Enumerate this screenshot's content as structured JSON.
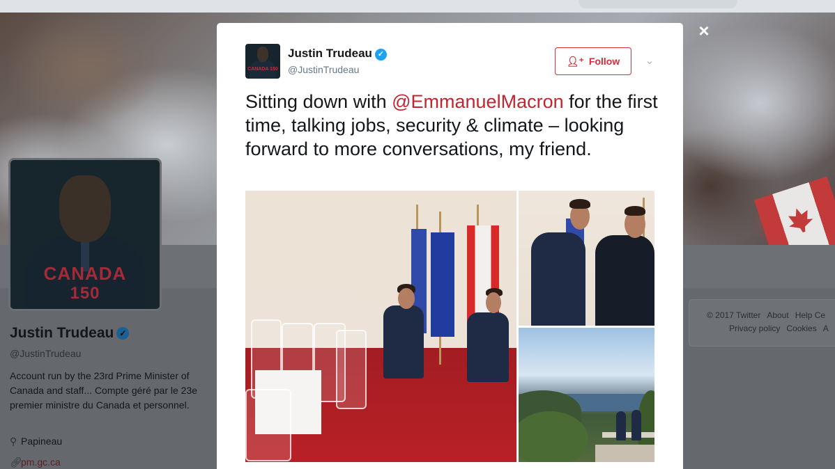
{
  "background": {
    "profile_name": "Justin Trudeau",
    "profile_handle": "@JustinTrudeau",
    "bio": "Account run by the 23rd Prime Minister of Canada and staff... Compte géré par le 23e premier ministre du Canada et personnel.",
    "location": "Papineau",
    "website": "pm.gc.ca",
    "avatar_text_1": "CANADA",
    "avatar_text_2": "150",
    "footer_links": [
      "© 2017 Twitter",
      "About",
      "Help Ce",
      "Privacy policy",
      "Cookies",
      "A"
    ]
  },
  "modal": {
    "close_label": "×",
    "author_name": "Justin Trudeau",
    "author_handle": "@JustinTrudeau",
    "verified_badge": "✓",
    "follow_label": "Follow",
    "follow_icon": "person-plus-icon",
    "more_icon": "chevron-down-icon",
    "avatar_logo": "CANADA 150",
    "tweet_prefix": "Sitting down with ",
    "tweet_mention": "@EmmanuelMacron",
    "tweet_suffix": " for the first time, talking jobs, security & climate – looking forward to more conversations, my friend."
  },
  "colors": {
    "accent_red": "#d62d38",
    "mention_red": "#c0262f",
    "verified_blue": "#1da1f2",
    "handle_gray": "#657786"
  }
}
